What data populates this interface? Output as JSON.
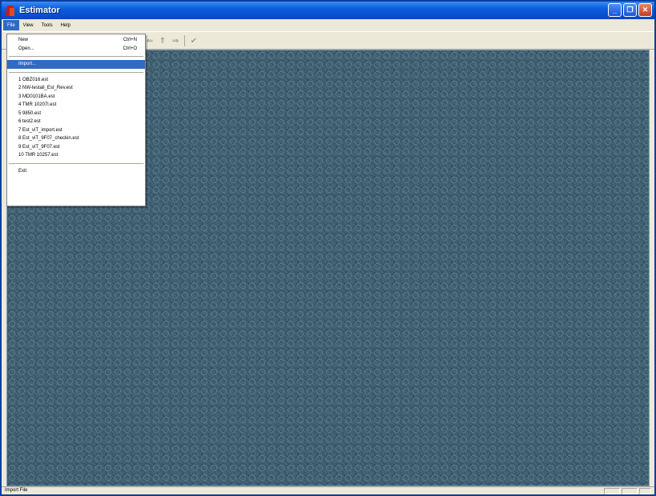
{
  "window": {
    "title": "Estimator"
  },
  "menubar": {
    "items": [
      "File",
      "View",
      "Tools",
      "Help"
    ]
  },
  "file_menu": {
    "new_label": "New",
    "new_shortcut": "Ctrl+N",
    "open_label": "Open...",
    "open_shortcut": "Ctrl+O",
    "import_label": "Import...",
    "recent": [
      "1 OBZ016.est",
      "2 NW-testall_Est_Rev.est",
      "3 MD0101BA.est",
      "4 TMR 10207l.est",
      "5 9850.est",
      "6 test2.est",
      "7 Est_viT_import.est",
      "8 Est_viT_9F07_checkin.est",
      "9 Est_viT_9F07.est",
      "10 TMR 10257.est"
    ],
    "exit_label": "Exit"
  },
  "statusbar": {
    "text": "Import File"
  },
  "colors": {
    "titlebar": "#0a5ee0",
    "highlight": "#316ac5",
    "workspace": "#3d5f72",
    "close_button": "#c43c1c"
  },
  "icons": [
    "app-icon",
    "minimize-icon",
    "restore-icon",
    "close-icon",
    "arrow-left-icon",
    "arrow-up-icon",
    "arrow-right-icon",
    "checkmark-icon"
  ]
}
